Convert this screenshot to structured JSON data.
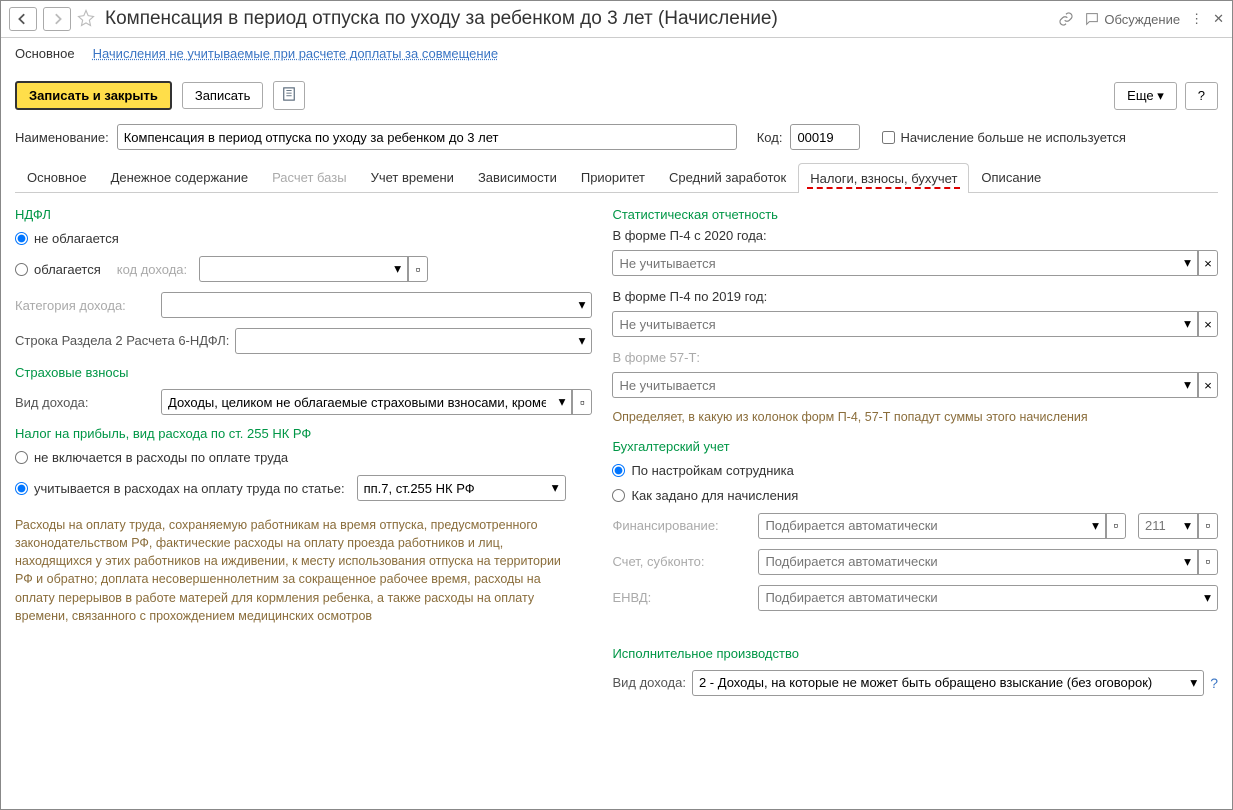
{
  "title": "Компенсация в период отпуска по уходу за ребенком до 3 лет (Начисление)",
  "titlebar": {
    "discussion": "Обсуждение"
  },
  "nav": {
    "main": "Основное",
    "link1": "Начисления не учитываемые при расчете доплаты за совмещение"
  },
  "toolbar": {
    "save_close": "Записать и закрыть",
    "save": "Записать",
    "more": "Еще",
    "help": "?"
  },
  "topform": {
    "name_label": "Наименование:",
    "name_value": "Компенсация в период отпуска по уходу за ребенком до 3 лет",
    "code_label": "Код:",
    "code_value": "00019",
    "notused_label": "Начисление больше не используется"
  },
  "tabs": [
    "Основное",
    "Денежное содержание",
    "Расчет базы",
    "Учет времени",
    "Зависимости",
    "Приоритет",
    "Средний заработок",
    "Налоги, взносы, бухучет",
    "Описание"
  ],
  "tabs_disabled_index": 2,
  "tabs_active_index": 7,
  "left": {
    "ndfl_title": "НДФЛ",
    "ndfl_opt1": "не облагается",
    "ndfl_opt2": "облагается",
    "code_income_label": "код дохода:",
    "cat_income_label": "Категория дохода:",
    "row2_label": "Строка Раздела 2 Расчета 6-НДФЛ:",
    "ins_title": "Страховые взносы",
    "ins_kind_label": "Вид дохода:",
    "ins_kind_value": "Доходы, целиком не облагаемые страховыми взносами, кроме пособий",
    "profit_title": "Налог на прибыль, вид расхода по ст. 255 НК РФ",
    "profit_opt1": "не включается в расходы по оплате труда",
    "profit_opt2": "учитывается в расходах на оплату труда по статье:",
    "profit_article": "пп.7, ст.255 НК РФ",
    "profit_help": "Расходы на оплату труда, сохраняемую работникам на время отпуска, предусмотренного законодательством РФ, фактические расходы на оплату проезда работников и лиц, находящихся у этих работников на иждивении, к месту использования отпуска на территории РФ и обратно; доплата несовершеннолетним за сокращенное рабочее время, расходы на оплату перерывов в работе матерей для кормления ребенка, а также расходы на оплату времени, связанного с прохождением медицинских осмотров"
  },
  "right": {
    "stat_title": "Статистическая отчетность",
    "p4_2020_label": "В форме П-4 с 2020 года:",
    "p4_2019_label": "В форме П-4 по 2019 год:",
    "p57t_label": "В форме 57-Т:",
    "not_counted": "Не учитывается",
    "stat_hint": "Определяет, в какую из колонок форм П-4, 57-Т попадут суммы этого начисления",
    "buh_title": "Бухгалтерский учет",
    "buh_opt1": "По настройкам сотрудника",
    "buh_opt2": "Как задано для начисления",
    "fin_label": "Финансирование:",
    "account_label": "Счет, субконто:",
    "envd_label": "ЕНВД:",
    "auto_placeholder": "Подбирается автоматически",
    "small211": "211",
    "exec_title": "Исполнительное производство",
    "exec_kind_label": "Вид дохода:",
    "exec_value": "2 - Доходы, на которые не может быть обращено взыскание (без оговорок)"
  }
}
